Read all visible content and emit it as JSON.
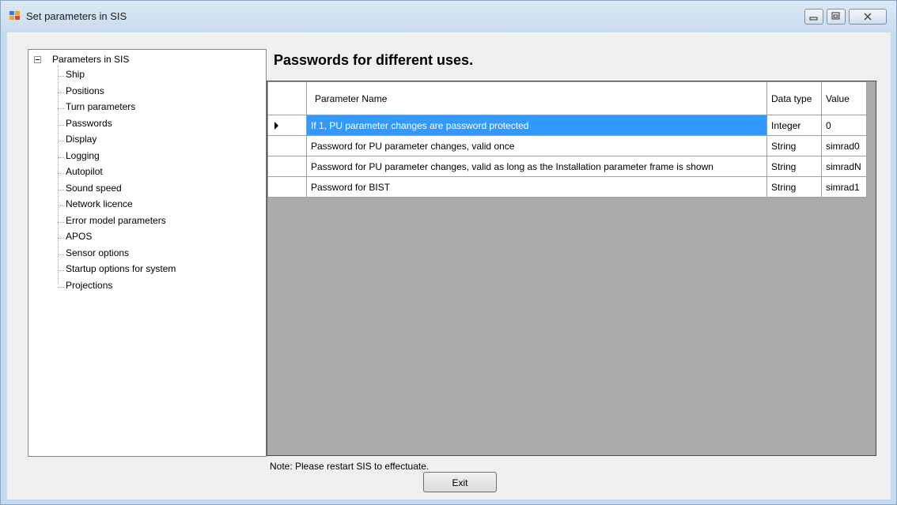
{
  "window": {
    "title": "Set parameters in SIS",
    "icon": "app-window-icon"
  },
  "tree": {
    "root_label": "Parameters in SIS",
    "items": [
      {
        "label": "Ship"
      },
      {
        "label": "Positions"
      },
      {
        "label": "Turn parameters"
      },
      {
        "label": "Passwords"
      },
      {
        "label": "Display"
      },
      {
        "label": "Logging"
      },
      {
        "label": "Autopilot"
      },
      {
        "label": "Sound speed"
      },
      {
        "label": "Network licence"
      },
      {
        "label": "Error model parameters"
      },
      {
        "label": "APOS"
      },
      {
        "label": "Sensor options"
      },
      {
        "label": "Startup options for system"
      },
      {
        "label": "Projections"
      }
    ]
  },
  "panel": {
    "heading": "Passwords for different uses.",
    "columns": {
      "name": "Parameter Name",
      "dtype": "Data type",
      "value": "Value"
    },
    "rows": [
      {
        "name": "If 1, PU parameter changes are password protected",
        "dtype": "Integer",
        "value": "0"
      },
      {
        "name": "Password for PU parameter changes, valid once",
        "dtype": "String",
        "value": "simrad0"
      },
      {
        "name": "Password for PU parameter changes, valid as long as the Installation parameter frame is shown",
        "dtype": "String",
        "value": "simradN"
      },
      {
        "name": "Password for BIST",
        "dtype": "String",
        "value": "simrad1"
      }
    ]
  },
  "footer": {
    "note": "Note: Please restart SIS to effectuate.",
    "exit_label": "Exit"
  },
  "colors": {
    "selection": "#3399ff",
    "grid_background": "#ababab",
    "titlebar": "#c9dcee"
  }
}
